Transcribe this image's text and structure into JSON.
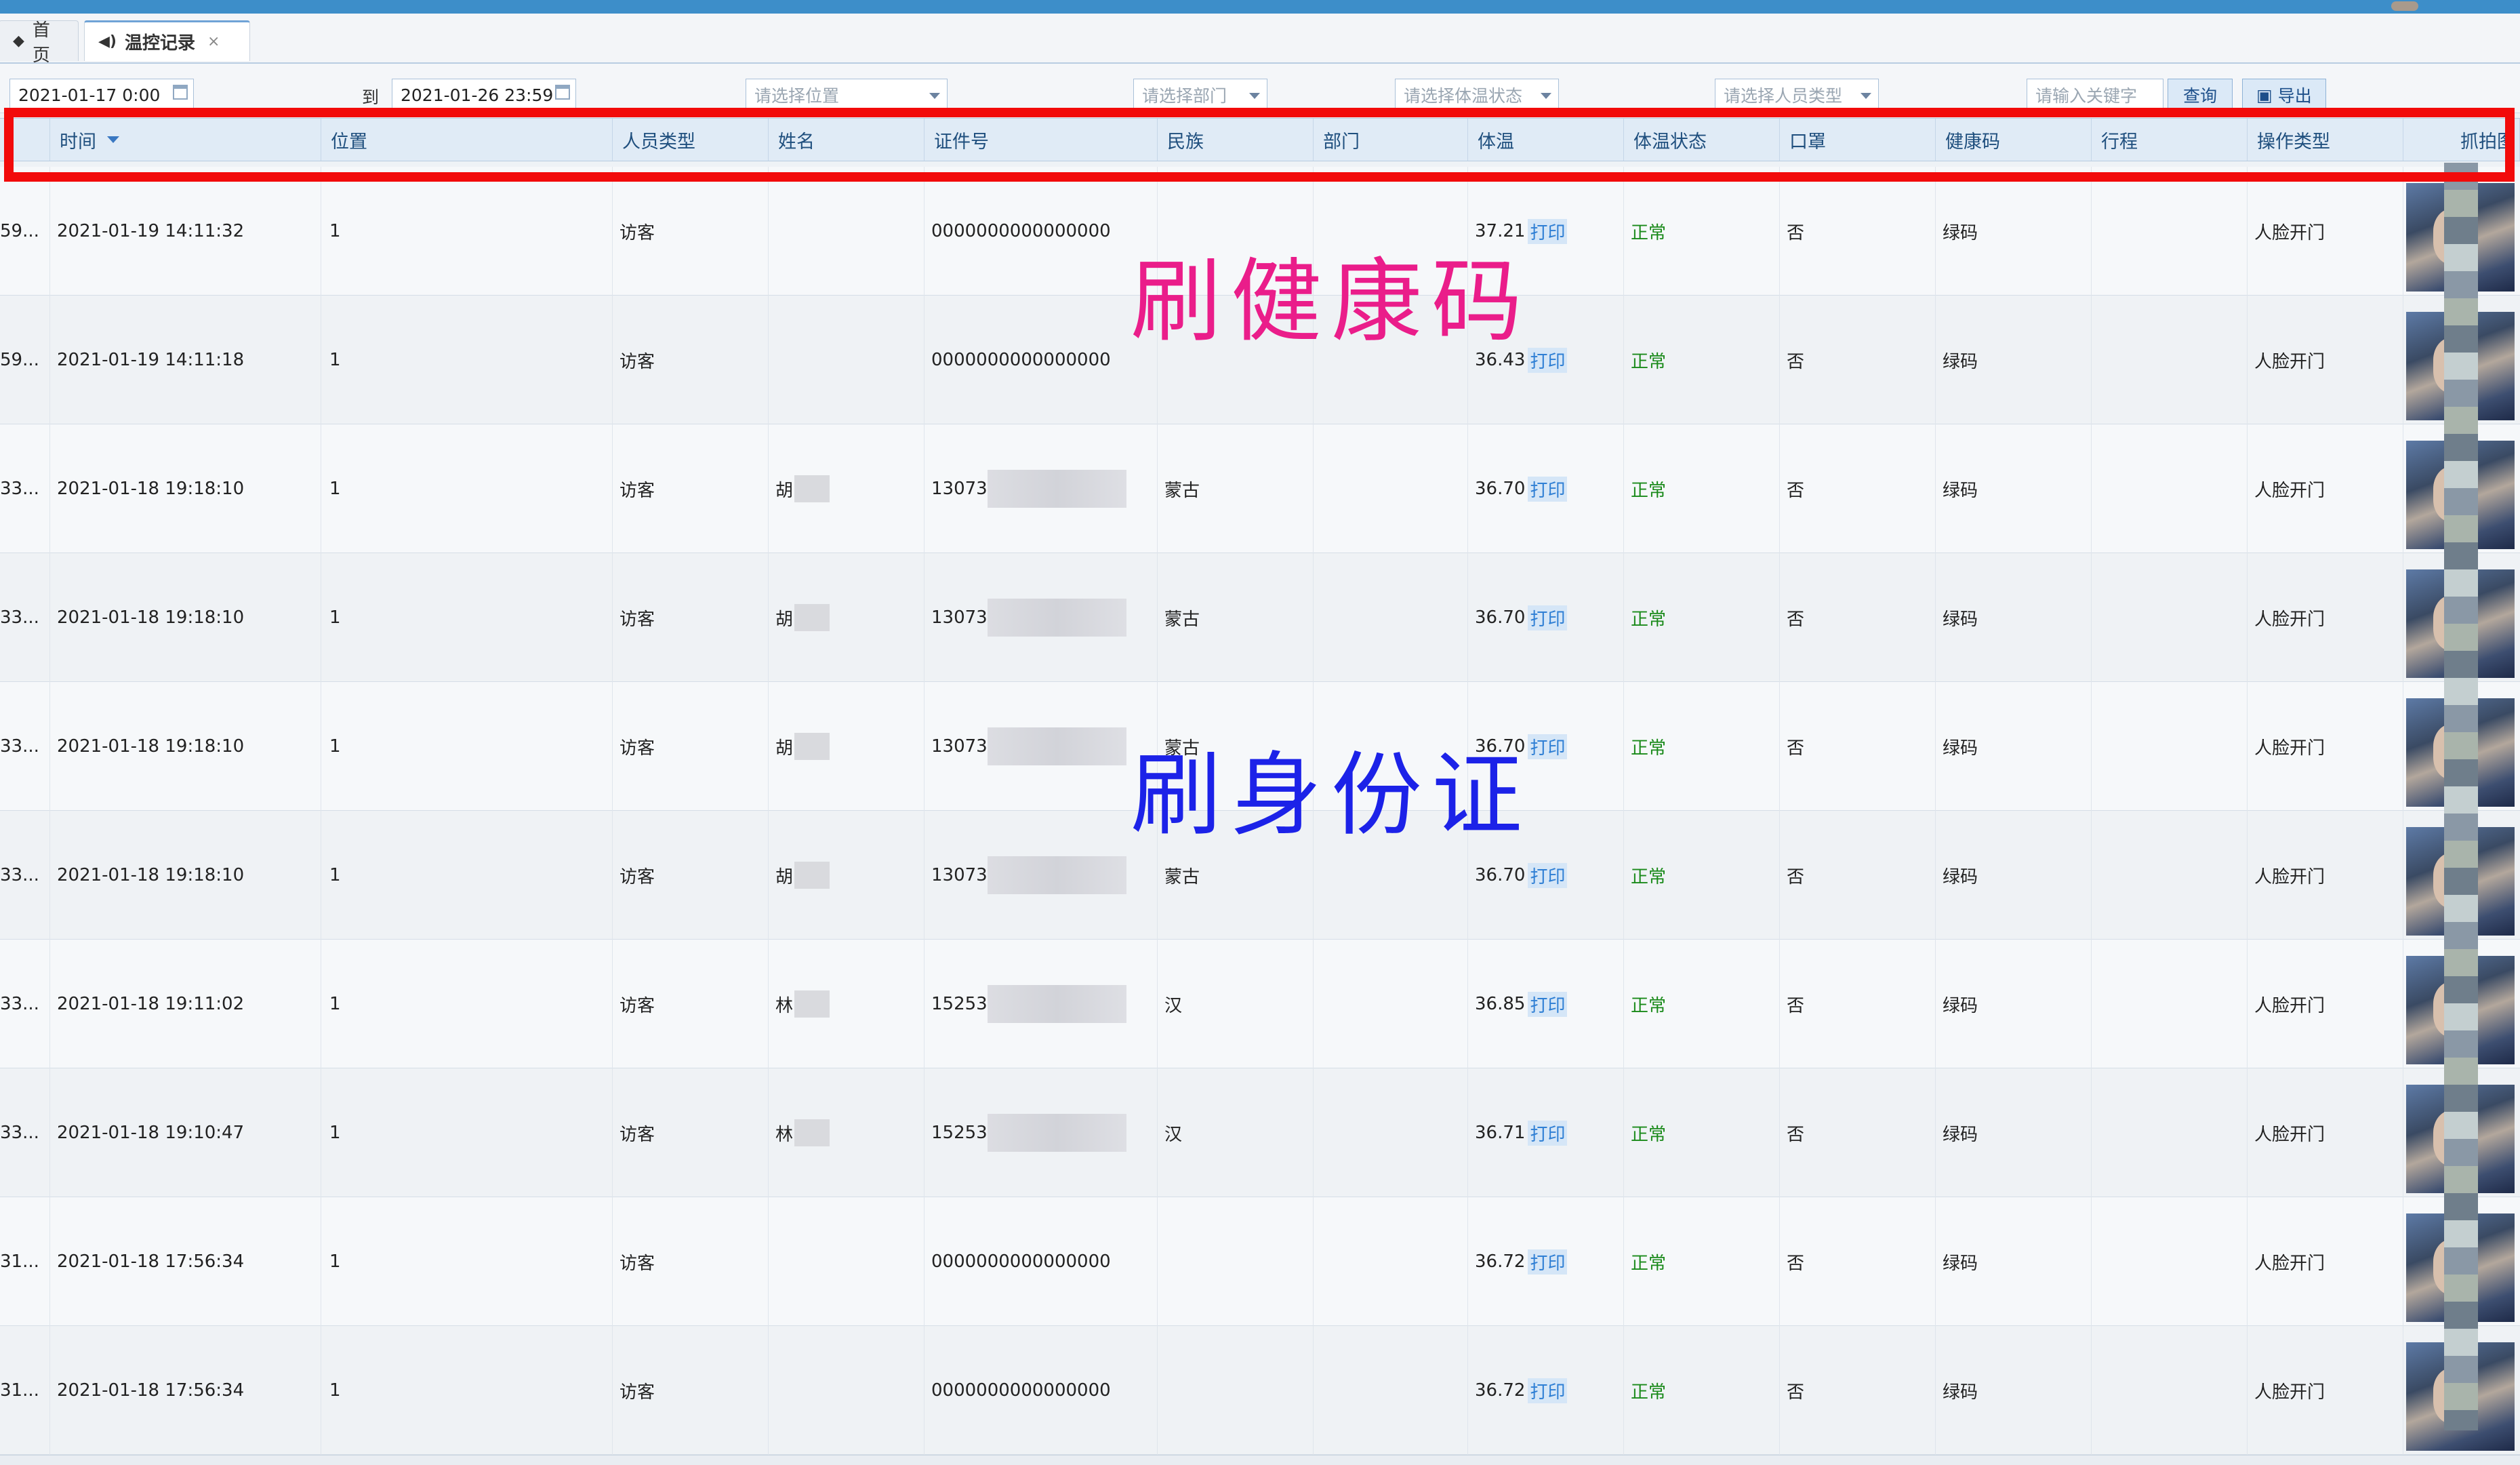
{
  "tabs": [
    {
      "label": "首页",
      "icon": "home-icon"
    },
    {
      "label": "温控记录",
      "icon": "speaker-icon",
      "close": "×"
    }
  ],
  "filters": {
    "start": "2021-01-17 0:00",
    "to_label": "到",
    "end": "2021-01-26 23:59",
    "location_ph": "请选择位置",
    "dept_ph": "请选择部门",
    "temp_status_ph": "请选择体温状态",
    "person_type_ph": "请选择人员类型",
    "keyword_ph": "请输入关键字",
    "query_label": "查询",
    "export_label": "导出"
  },
  "columns": [
    "时间",
    "位置",
    "人员类型",
    "姓名",
    "证件号",
    "民族",
    "部门",
    "体温",
    "体温状态",
    "口罩",
    "健康码",
    "行程",
    "操作类型",
    "抓拍图"
  ],
  "print_label": "打印",
  "rows": [
    {
      "id": "59...",
      "time": "2021-01-19 14:11:32",
      "loc": "1",
      "ptype": "访客",
      "name": "",
      "idno": "0000000000000000",
      "eth": "",
      "dept": "",
      "temp": "37.21",
      "status": "正常",
      "mask": "否",
      "code": "绿码",
      "trip": "",
      "op": "人脸开门"
    },
    {
      "id": "59...",
      "time": "2021-01-19 14:11:18",
      "loc": "1",
      "ptype": "访客",
      "name": "",
      "idno": "0000000000000000",
      "eth": "",
      "dept": "",
      "temp": "36.43",
      "status": "正常",
      "mask": "否",
      "code": "绿码",
      "trip": "",
      "op": "人脸开门"
    },
    {
      "id": "33...",
      "time": "2021-01-18 19:18:10",
      "loc": "1",
      "ptype": "访客",
      "name": "胡",
      "idno": "13073",
      "eth": "蒙古",
      "dept": "",
      "temp": "36.70",
      "status": "正常",
      "mask": "否",
      "code": "绿码",
      "trip": "",
      "op": "人脸开门"
    },
    {
      "id": "33...",
      "time": "2021-01-18 19:18:10",
      "loc": "1",
      "ptype": "访客",
      "name": "胡",
      "idno": "13073",
      "eth": "蒙古",
      "dept": "",
      "temp": "36.70",
      "status": "正常",
      "mask": "否",
      "code": "绿码",
      "trip": "",
      "op": "人脸开门"
    },
    {
      "id": "33...",
      "time": "2021-01-18 19:18:10",
      "loc": "1",
      "ptype": "访客",
      "name": "胡",
      "idno": "13073",
      "eth": "蒙古",
      "dept": "",
      "temp": "36.70",
      "status": "正常",
      "mask": "否",
      "code": "绿码",
      "trip": "",
      "op": "人脸开门"
    },
    {
      "id": "33...",
      "time": "2021-01-18 19:18:10",
      "loc": "1",
      "ptype": "访客",
      "name": "胡",
      "idno": "13073",
      "eth": "蒙古",
      "dept": "",
      "temp": "36.70",
      "status": "正常",
      "mask": "否",
      "code": "绿码",
      "trip": "",
      "op": "人脸开门"
    },
    {
      "id": "33...",
      "time": "2021-01-18 19:11:02",
      "loc": "1",
      "ptype": "访客",
      "name": "林",
      "idno": "15253",
      "eth": "汉",
      "dept": "",
      "temp": "36.85",
      "status": "正常",
      "mask": "否",
      "code": "绿码",
      "trip": "",
      "op": "人脸开门"
    },
    {
      "id": "33...",
      "time": "2021-01-18 19:10:47",
      "loc": "1",
      "ptype": "访客",
      "name": "林",
      "idno": "15253",
      "eth": "汉",
      "dept": "",
      "temp": "36.71",
      "status": "正常",
      "mask": "否",
      "code": "绿码",
      "trip": "",
      "op": "人脸开门"
    },
    {
      "id": "31...",
      "time": "2021-01-18 17:56:34",
      "loc": "1",
      "ptype": "访客",
      "name": "",
      "idno": "0000000000000000",
      "eth": "",
      "dept": "",
      "temp": "36.72",
      "status": "正常",
      "mask": "否",
      "code": "绿码",
      "trip": "",
      "op": "人脸开门"
    },
    {
      "id": "31...",
      "time": "2021-01-18 17:56:34",
      "loc": "1",
      "ptype": "访客",
      "name": "",
      "idno": "0000000000000000",
      "eth": "",
      "dept": "",
      "temp": "36.72",
      "status": "正常",
      "mask": "否",
      "code": "绿码",
      "trip": "",
      "op": "人脸开门"
    }
  ],
  "overlays": {
    "top": "刷健康码",
    "bottom": "刷身份证"
  },
  "colors": {
    "highlight": "#f20b0b",
    "overlay_top": "#ea1d8a",
    "overlay_bottom": "#1c22e8",
    "status_ok": "#1a8a1a"
  }
}
